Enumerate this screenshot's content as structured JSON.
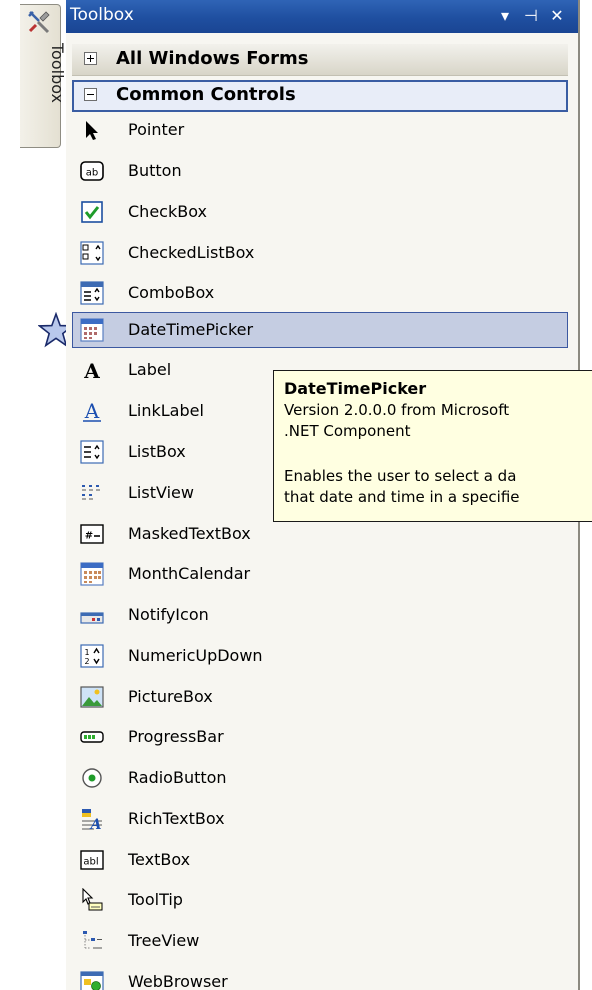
{
  "side_tab": {
    "label": "Toolbox",
    "icon": "toolbox-icon"
  },
  "marker": {
    "icon": "star-icon"
  },
  "titlebar": {
    "title": "Toolbox",
    "buttons": [
      {
        "name": "dropdown-icon",
        "glyph": "▾"
      },
      {
        "name": "pin-icon",
        "glyph": "⊣"
      },
      {
        "name": "close-icon",
        "glyph": "✕"
      }
    ],
    "color": "#2358a8"
  },
  "categories": [
    {
      "label": "All Windows Forms",
      "expanded": false
    },
    {
      "label": "Common Controls",
      "expanded": true
    }
  ],
  "items": [
    {
      "label": "Pointer",
      "icon": "pointer-icon"
    },
    {
      "label": "Button",
      "icon": "button-icon"
    },
    {
      "label": "CheckBox",
      "icon": "checkbox-icon"
    },
    {
      "label": "CheckedListBox",
      "icon": "checkedlistbox-icon"
    },
    {
      "label": "ComboBox",
      "icon": "combobox-icon"
    },
    {
      "label": "DateTimePicker",
      "icon": "datetimepicker-icon",
      "selected": true
    },
    {
      "label": "Label",
      "icon": "label-icon"
    },
    {
      "label": "LinkLabel",
      "icon": "linklabel-icon"
    },
    {
      "label": "ListBox",
      "icon": "listbox-icon"
    },
    {
      "label": "ListView",
      "icon": "listview-icon"
    },
    {
      "label": "MaskedTextBox",
      "icon": "maskedtextbox-icon"
    },
    {
      "label": "MonthCalendar",
      "icon": "monthcalendar-icon"
    },
    {
      "label": "NotifyIcon",
      "icon": "notifyicon-icon"
    },
    {
      "label": "NumericUpDown",
      "icon": "numericupdown-icon"
    },
    {
      "label": "PictureBox",
      "icon": "picturebox-icon"
    },
    {
      "label": "ProgressBar",
      "icon": "progressbar-icon"
    },
    {
      "label": "RadioButton",
      "icon": "radiobutton-icon"
    },
    {
      "label": "RichTextBox",
      "icon": "richtextbox-icon"
    },
    {
      "label": "TextBox",
      "icon": "textbox-icon"
    },
    {
      "label": "ToolTip",
      "icon": "tooltip-icon"
    },
    {
      "label": "TreeView",
      "icon": "treeview-icon"
    },
    {
      "label": "WebBrowser",
      "icon": "webbrowser-icon"
    }
  ],
  "tooltip": {
    "title": "DateTimePicker",
    "version": "Version 2.0.0.0 from Microsoft",
    "component": ".NET Component",
    "desc1": "Enables the user to select a da",
    "desc2": "that date and time in a specifie",
    "background": "#ffffe1"
  }
}
